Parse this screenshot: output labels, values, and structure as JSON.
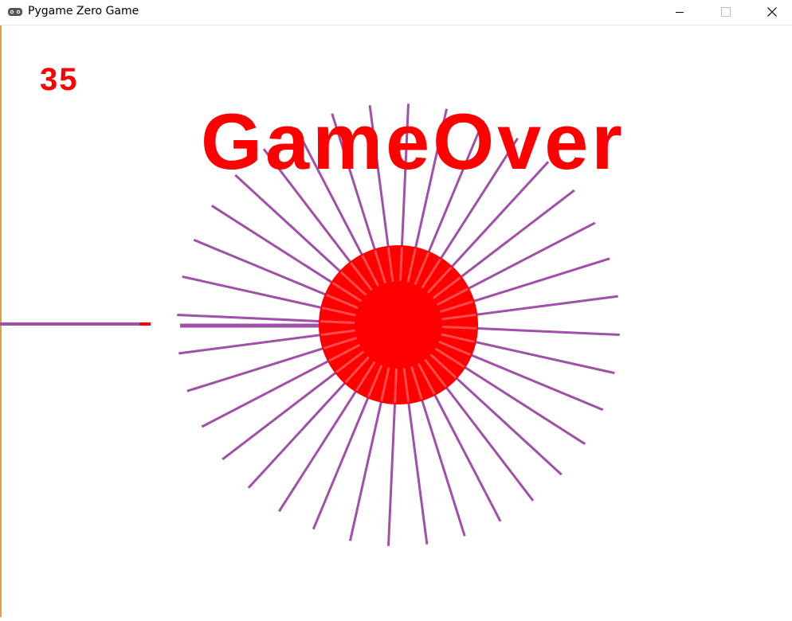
{
  "window": {
    "title": "Pygame Zero Game",
    "icon": "gamepad-icon",
    "controls": [
      "minimize-icon",
      "maximize-icon",
      "close-icon"
    ]
  },
  "game": {
    "score": "35",
    "message": "GameOver",
    "needle_count": 36,
    "colors": {
      "background": "#ffffff",
      "text": "#ff0000",
      "ball": "#ff0000",
      "needle": "#a050a8"
    }
  }
}
